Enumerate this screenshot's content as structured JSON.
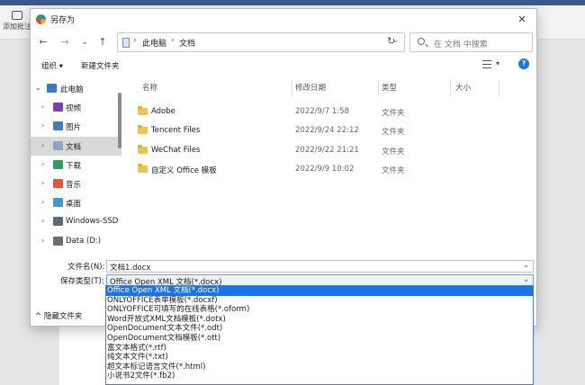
{
  "background": {
    "comment_label": "添加批注"
  },
  "dialog": {
    "title": "另存为",
    "close": "✕"
  },
  "nav": {
    "back": "←",
    "forward": "→",
    "recent": "⌄",
    "up": "↑",
    "breadcrumb": [
      "此电脑",
      "文档"
    ],
    "refresh": "↻",
    "search_placeholder": "在 文档 中搜索"
  },
  "toolbar": {
    "organize": "组织 ▾",
    "new_folder": "新建文件夹",
    "help": "?"
  },
  "tree": {
    "items": [
      {
        "label": "此电脑",
        "icon": "computer-icon",
        "color": "#3a78c9",
        "selected": false,
        "root": true,
        "chevron": "⌄"
      },
      {
        "label": "视频",
        "icon": "video-icon",
        "color": "#7b3fb3",
        "selected": false,
        "chevron": "›"
      },
      {
        "label": "图片",
        "icon": "picture-icon",
        "color": "#3d7fc4",
        "selected": false,
        "chevron": "›"
      },
      {
        "label": "文档",
        "icon": "document-icon",
        "color": "#8aa4c4",
        "selected": true,
        "chevron": "›"
      },
      {
        "label": "下载",
        "icon": "download-icon",
        "color": "#2ca05a",
        "selected": false,
        "chevron": "›"
      },
      {
        "label": "音乐",
        "icon": "music-icon",
        "color": "#e5533d",
        "selected": false,
        "chevron": "›"
      },
      {
        "label": "桌面",
        "icon": "desktop-icon",
        "color": "#3a9bd8",
        "selected": false,
        "chevron": "›"
      },
      {
        "label": "Windows-SSD",
        "icon": "drive-icon",
        "color": "#5a6b80",
        "selected": false,
        "chevron": "›"
      },
      {
        "label": "Data (D:)",
        "icon": "drive-icon",
        "color": "#6d6d6d",
        "selected": false,
        "chevron": "›"
      }
    ]
  },
  "list": {
    "columns": [
      "名称",
      "修改日期",
      "类型",
      "大小"
    ],
    "rows": [
      {
        "name": "Adobe",
        "date": "2022/9/7 1:58",
        "type": "文件夹"
      },
      {
        "name": "Tencent Files",
        "date": "2022/9/24 22:12",
        "type": "文件夹"
      },
      {
        "name": "WeChat Files",
        "date": "2022/9/22 21:21",
        "type": "文件夹"
      },
      {
        "name": "自定义 Office 模板",
        "date": "2022/9/9 10:02",
        "type": "文件夹"
      }
    ]
  },
  "fields": {
    "filename_label": "文件名(N):",
    "filename_value": "文档1.docx",
    "filetype_label": "保存类型(T):",
    "filetype_value": "Office Open XML 文档(*.docx)",
    "hide_folders": "隐藏文件夹",
    "dropdown_arrow": "⌄"
  },
  "dropdown": {
    "options": [
      "Office Open XML 文档(*.docx)",
      "ONLYOFFICE表单模板(*.docxf)",
      "ONLYOFFICE可填写的在线表格(*.oform)",
      "Word开放式XML文档模板(*.dotx)",
      "OpenDocument文本文件(*.odt)",
      "OpenDocument文档模板(*.ott)",
      "富文本格式(*.rtf)",
      "纯文本文件(*.txt)",
      "超文本标记语言文件(*.html)",
      "小说书2文件(*.fb2)"
    ],
    "selected_index": 0,
    "accent": "#1a73e8"
  }
}
